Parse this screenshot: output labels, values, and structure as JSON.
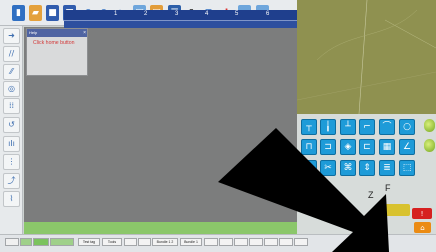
{
  "help_popup": {
    "title": "Help",
    "close": "×",
    "message": "Click home button"
  },
  "ruler": {
    "ticks": [
      "1",
      "2",
      "3",
      "4",
      "5",
      "6"
    ]
  },
  "status_tabs": [
    "",
    "",
    "",
    "",
    "Test tag",
    "Tools",
    "",
    "",
    "Bundle 1 2",
    "Bundle 1",
    "",
    "",
    "",
    "",
    "",
    "",
    ""
  ],
  "palette_right": {
    "side_top": "",
    "side_bottom": ""
  },
  "bottom_labels": {
    "z_label": "Z",
    "f_label": "F",
    "stop": "!",
    "home": "⌂",
    "status_right": ""
  },
  "colors": {
    "accent_blue": "#1e9bd8",
    "ruler_blue": "#1f3f8d",
    "stop_red": "#d62020",
    "home_orange": "#eb8b13",
    "brush_yellow": "#d8c22e"
  }
}
